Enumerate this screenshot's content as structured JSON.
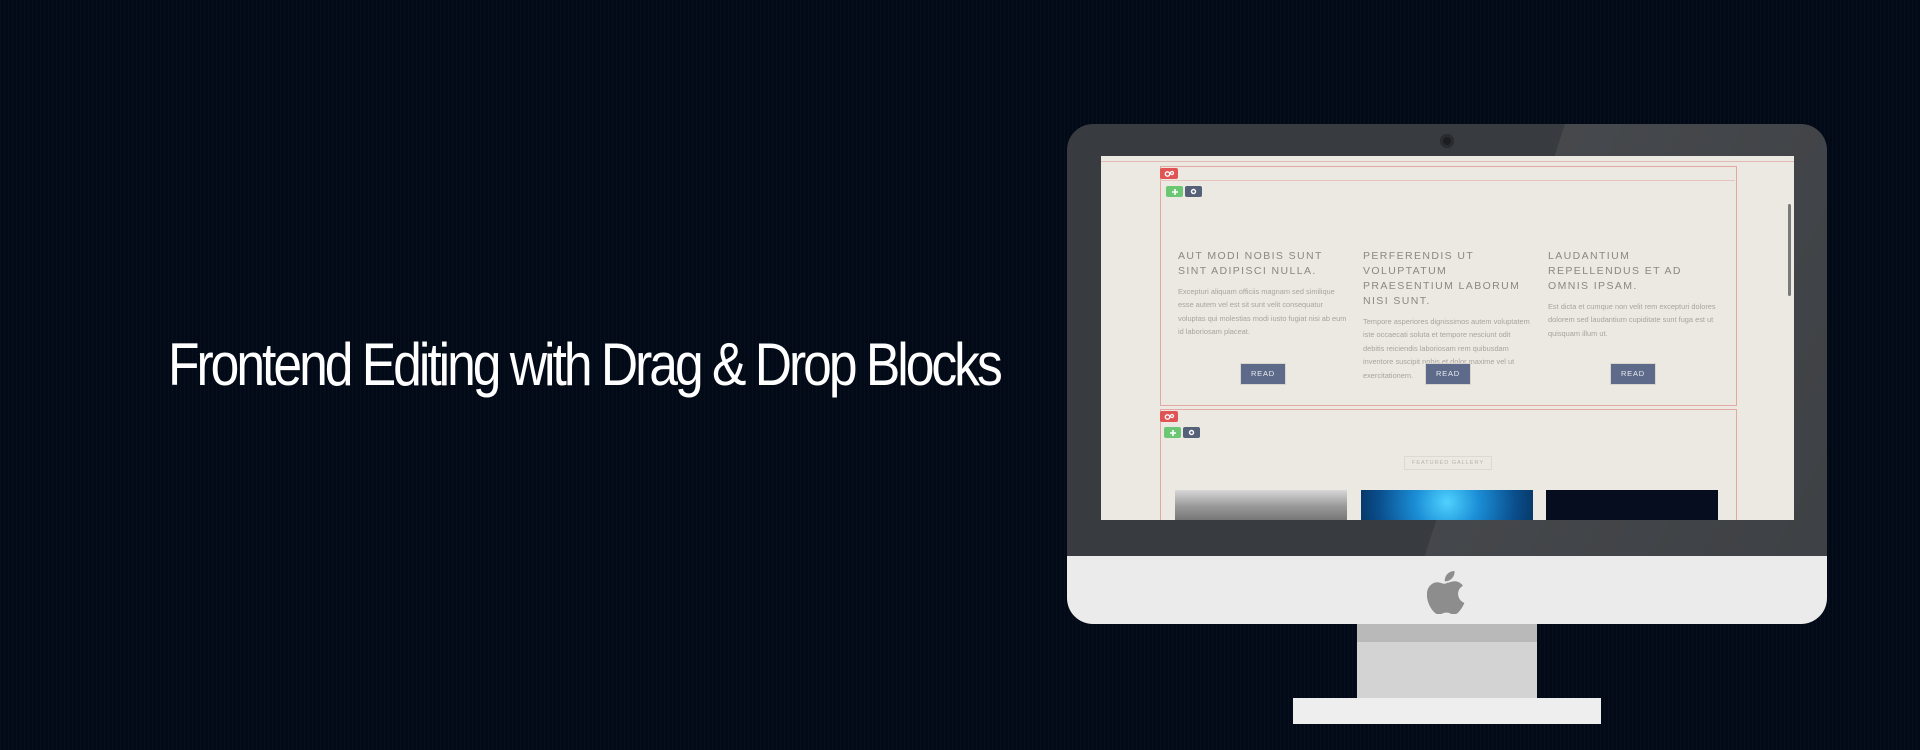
{
  "headline": "Frontend Editing with Drag & Drop Blocks",
  "colors": {
    "background": "#020a18",
    "bezel": "#383b3f",
    "screen": "#ece8e2",
    "block_outline": "#e3a8a4",
    "settings_red": "#e05454",
    "add_green": "#6cc774",
    "gear_slate": "#556178",
    "read_button": "#5e6a8a"
  },
  "screen": {
    "block1": {
      "columns": [
        {
          "title": "AUT MODI NOBIS SUNT SINT ADIPISCI NULLA.",
          "text": "Excepturi aliquam officiis magnam sed similique esse autem vel est sit sunt velit consequatur voluptas qui molestias modi iusto fugiat nisi ab eum id laboriosam placeat.",
          "button": "READ"
        },
        {
          "title": "PERFERENDIS UT VOLUPTATUM PRAESENTIUM LABORUM NISI SUNT.",
          "text": "Tempore asperiores dignissimos autem voluptatem iste occaecati soluta et tempore nesciunt odit debitis reiciendis laboriosam rem quibusdam inventore suscipit nobis et dolor maxime vel ut exercitationem.",
          "button": "READ"
        },
        {
          "title": "LAUDANTIUM REPELLENDUS ET AD OMNIS IPSAM.",
          "text": "Est dicta et cumque non velit rem excepturi dolores dolorem sed laudantium cupiditate sunt fuga est ut quisquam illum ut.",
          "button": "READ"
        }
      ]
    },
    "block2": {
      "section_label": "FEATURED GALLERY"
    }
  },
  "icons": {
    "block_settings": "cogs-icon",
    "add_block": "plus-icon",
    "block_options": "gear-icon",
    "brand": "apple-logo-icon"
  }
}
